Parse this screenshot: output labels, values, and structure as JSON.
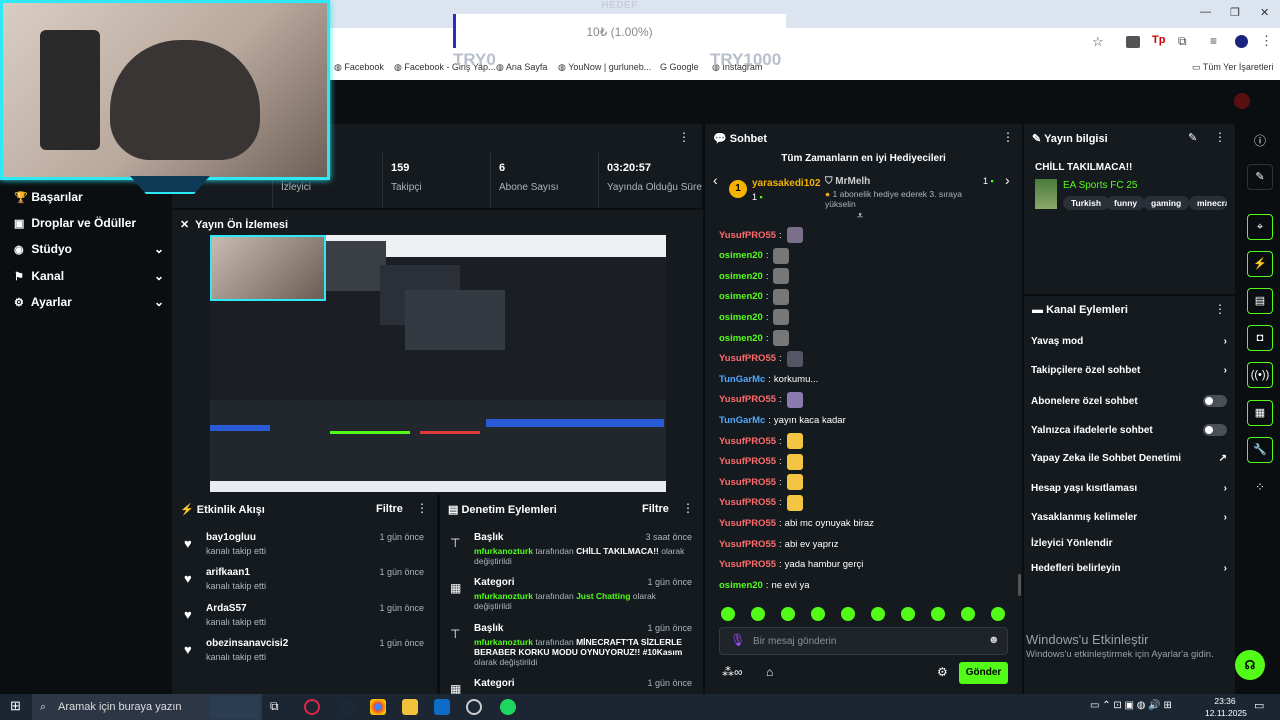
{
  "goal": {
    "title": "HEDEF",
    "amount": "10₺ (1.00%)",
    "min": "TRY0",
    "max": "TRY1000"
  },
  "bookmarks": [
    {
      "label": "Facebook"
    },
    {
      "label": "Facebook - Giriş Yap..."
    },
    {
      "label": "Ana Sayfa"
    },
    {
      "label": "YouNow | gurluneb..."
    },
    {
      "label": "Google"
    },
    {
      "label": "Instagram"
    }
  ],
  "bookmarks_all": "Tüm Yer İşaretleri",
  "nav": {
    "items": [
      {
        "label": "Başarılar"
      },
      {
        "label": "Droplar ve Ödüller"
      },
      {
        "label": "Stüdyo"
      },
      {
        "label": "Kanal"
      },
      {
        "label": "Ayarlar"
      }
    ]
  },
  "stats": {
    "viewers_label": "İzleyici",
    "followers_value": "159",
    "followers_label": "Takipçi",
    "subs_value": "6",
    "subs_label": "Abone Sayısı",
    "uptime_value": "03:20:57",
    "uptime_label": "Yayında Olduğu Süre"
  },
  "preview": {
    "title": "Yayın Ön İzlemesi"
  },
  "activity": {
    "title": "Etkinlik Akışı",
    "filter": "Filtre",
    "items": [
      {
        "name": "bay1ogluu",
        "action": "kanalı takip etti",
        "time": "1 gün önce"
      },
      {
        "name": "arifkaan1",
        "action": "kanalı takip etti",
        "time": "1 gün önce"
      },
      {
        "name": "ArdaS57",
        "action": "kanalı takip etti",
        "time": "1 gün önce"
      },
      {
        "name": "obezinsanavcisi2",
        "action": "kanalı takip etti",
        "time": "1 gün önce"
      }
    ]
  },
  "moderation": {
    "title": "Denetim Eylemleri",
    "filter": "Filtre",
    "items": [
      {
        "type": "Başlık",
        "time": "3 saat önce",
        "user": "mfurkanozturk",
        "mid": "tarafından",
        "value": "CHİLL TAKILMACA!!",
        "end": "olarak değiştirildi"
      },
      {
        "type": "Kategori",
        "time": "1 gün önce",
        "user": "mfurkanozturk",
        "mid": "tarafından",
        "value": "Just Chatting",
        "end": "olarak değiştirildi"
      },
      {
        "type": "Başlık",
        "time": "1 gün önce",
        "user": "mfurkanozturk",
        "mid": "tarafından",
        "value": "MİNECRAFT'TA SİZLERLE BERABER KORKU MODU OYNUYORUZ!! #10Kasım",
        "end": "olarak değiştirildi"
      },
      {
        "type": "Kategori",
        "time": "1 gün önce"
      }
    ]
  },
  "chat": {
    "title": "Sohbet",
    "top_gifters_title": "Tüm Zamanların en iyi Hediyecileri",
    "gifter1": {
      "rank": "1",
      "name": "yarasakedi102",
      "count": "1"
    },
    "gifter2": {
      "name": "MrMelh",
      "desc": "1 abonelik hediye ederek 3. sıraya yükselin",
      "count": "1"
    },
    "messages": [
      {
        "user": "YusufPRO55",
        "text": "",
        "color": "#ff6b6b"
      },
      {
        "user": "osimen20",
        "text": "",
        "color": "#53fc18"
      },
      {
        "user": "osimen20",
        "text": "",
        "color": "#53fc18"
      },
      {
        "user": "osimen20",
        "text": "",
        "color": "#53fc18"
      },
      {
        "user": "osimen20",
        "text": "",
        "color": "#53fc18"
      },
      {
        "user": "osimen20",
        "text": "",
        "color": "#53fc18"
      },
      {
        "user": "YusufPRO55",
        "text": "",
        "color": "#ff6b6b"
      },
      {
        "user": "TunGarMc",
        "text": "korkumu...",
        "color": "#4fa8ff"
      },
      {
        "user": "YusufPRO55",
        "text": "",
        "color": "#ff6b6b"
      },
      {
        "user": "TunGarMc",
        "text": "yayın kaca kadar",
        "color": "#4fa8ff"
      },
      {
        "user": "YusufPRO55",
        "text": "",
        "color": "#ff6b6b"
      },
      {
        "user": "YusufPRO55",
        "text": "",
        "color": "#ff6b6b"
      },
      {
        "user": "YusufPRO55",
        "text": "",
        "color": "#ff6b6b"
      },
      {
        "user": "YusufPRO55",
        "text": "",
        "color": "#ff6b6b"
      },
      {
        "user": "YusufPRO55",
        "text": "abi mc oynuyak biraz",
        "color": "#ff6b6b"
      },
      {
        "user": "YusufPRO55",
        "text": "abi ev yaprız",
        "color": "#ff6b6b"
      },
      {
        "user": "YusufPRO55",
        "text": "yada hambur gerçi",
        "color": "#ff6b6b"
      },
      {
        "user": "osimen20",
        "text": "ne evi ya",
        "color": "#53fc18"
      }
    ],
    "input_placeholder": "Bir mesaj gönderin",
    "send_label": "Gönder"
  },
  "stream_info": {
    "title": "Yayın bilgisi",
    "stream_title": "CHİLL TAKILMACA!!",
    "category": "EA Sports FC 25",
    "tags": [
      "Turkish",
      "funny",
      "gaming",
      "minecra"
    ]
  },
  "channel_actions": {
    "title": "Kanal Eylemleri",
    "items": [
      {
        "label": "Yavaş mod"
      },
      {
        "label": "Takipçilere özel sohbet"
      },
      {
        "label": "Abonelere özel sohbet"
      },
      {
        "label": "Yalnızca ifadelerle sohbet"
      },
      {
        "label": "Yapay Zeka ile Sohbet Denetimi"
      },
      {
        "label": "Hesap yaşı kısıtlaması"
      },
      {
        "label": "Yasaklanmış kelimeler"
      },
      {
        "label": "İzleyici Yönlendir"
      },
      {
        "label": "Hedefleri belirleyin"
      }
    ]
  },
  "watermark": {
    "line1": "Windows'u Etkinleştir",
    "line2": "Windows'u etkinleştirmek için Ayarlar'a gidin."
  },
  "taskbar": {
    "search_placeholder": "Aramak için buraya yazın",
    "time": "23:36",
    "date": "12.11.2025"
  },
  "colors": {
    "accent": "#53fc18",
    "panel": "#151a1f",
    "bg": "#0b0e11",
    "cam_border": "#2ee8f5"
  }
}
